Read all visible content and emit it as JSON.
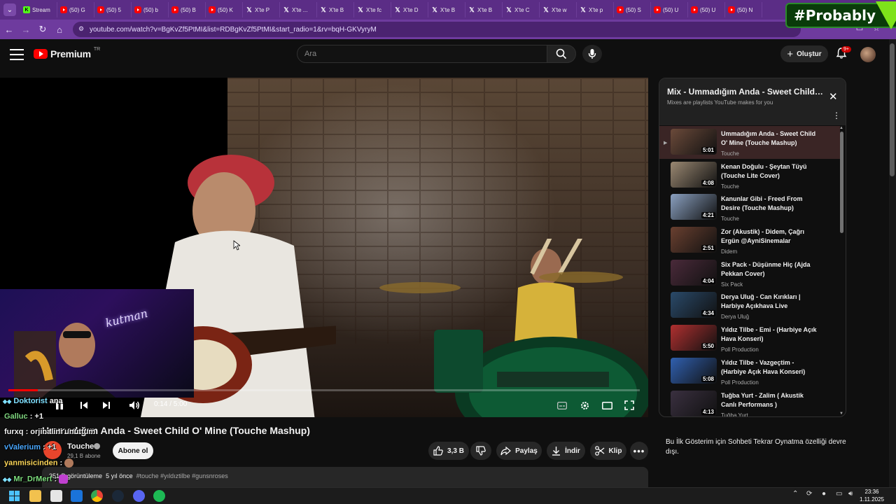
{
  "browser": {
    "tabs": [
      {
        "icon": "kick-icon",
        "label": "Stream"
      },
      {
        "icon": "youtube-icon",
        "label": "(50) G"
      },
      {
        "icon": "youtube-icon",
        "label": "(50) 5"
      },
      {
        "icon": "youtube-icon",
        "label": "(50) b"
      },
      {
        "icon": "youtube-icon",
        "label": "(50) B"
      },
      {
        "icon": "youtube-icon",
        "label": "(50) K"
      },
      {
        "icon": "x-icon",
        "label": "X'te P"
      },
      {
        "icon": "x-icon",
        "label": "X'te ..."
      },
      {
        "icon": "x-icon",
        "label": "X'te B"
      },
      {
        "icon": "x-icon",
        "label": "X'te fc"
      },
      {
        "icon": "x-icon",
        "label": "X'te D"
      },
      {
        "icon": "x-icon",
        "label": "X'te B"
      },
      {
        "icon": "x-icon",
        "label": "X'te B"
      },
      {
        "icon": "x-icon",
        "label": "X'te C"
      },
      {
        "icon": "x-icon",
        "label": "X'te w"
      },
      {
        "icon": "x-icon",
        "label": "X'te p"
      },
      {
        "icon": "youtube-icon",
        "label": "(50) S"
      },
      {
        "icon": "youtube-icon",
        "label": "(50) U"
      },
      {
        "icon": "youtube-icon",
        "label": "(50) U"
      },
      {
        "icon": "youtube-icon",
        "label": "(50) N"
      }
    ],
    "url": "youtube.com/watch?v=BgKvZf5PtMI&list=RDBgKvZf5PtMI&start_radio=1&rv=bqH-GKVyryM"
  },
  "overlay_badge": "#Probably",
  "youtube": {
    "logo_text": "Premium",
    "logo_sup": "TR",
    "search_placeholder": "Ara",
    "create_label": "Oluştur",
    "notif_count": "9+"
  },
  "player": {
    "time": "0:14 / 5:00",
    "progress": 0.047,
    "webcam_neon": "kutman"
  },
  "video": {
    "title": "Ummadığım Anda - Sweet Child O' Mine (Touche Mashup)",
    "channel": "Touche",
    "subscribers": "29,1 B abone",
    "subscribe_label": "Abone ol",
    "likes": "3,3 B",
    "share_label": "Paylaş",
    "download_label": "İndir",
    "clip_label": "Klip",
    "views": "351 B görüntüleme",
    "age": "5 yıl önce",
    "tags": "#touche #yıldıztilbe #gunsnroses"
  },
  "chat": [
    {
      "user": "Doktorist",
      "text": "ana",
      "color": "#7fe0ff"
    },
    {
      "user": "Galluc",
      "text": ": +1",
      "color": "#7fd67f"
    },
    {
      "user": "furxq",
      "text": ": orjinalini unuttum",
      "color": "#ffffff"
    },
    {
      "user": "vValerium",
      "text": ": +1",
      "color": "#4aa8ff"
    },
    {
      "user": "yanmisicinden",
      "text": ":",
      "color": "#ffd85a"
    },
    {
      "user": "Mr_DrMert",
      "text": ":",
      "color": "#7fe07f"
    }
  ],
  "playlist": {
    "title": "Mix - Ummadığım Anda - Sweet Child O' Mine (Touche Mashup)",
    "subtitle": "Mixes are playlists YouTube makes for you",
    "items": [
      {
        "title": "Ummadığım Anda - Sweet Child O' Mine (Touche Mashup)",
        "channel": "Touche",
        "duration": "5:01",
        "current": true,
        "thumb": "#6b4a3a"
      },
      {
        "title": "Kenan Doğulu - Şeytan Tüyü (Touche Lite Cover)",
        "channel": "Touche",
        "duration": "4:08",
        "current": false,
        "thumb": "#9a8872"
      },
      {
        "title": "Kanunlar Gibi - Freed From Desire (Touche Mashup)",
        "channel": "Touche",
        "duration": "4:21",
        "current": false,
        "thumb": "#8aa0c0"
      },
      {
        "title": "Zor (Akustik) - Didem, Çağrı Ergün @AyniSinemalar",
        "channel": "Didem",
        "duration": "2:51",
        "current": false,
        "thumb": "#6a4030"
      },
      {
        "title": "Six Pack - Düşünme Hiç (Ajda Pekkan Cover)",
        "channel": "Six Pack",
        "duration": "4:04",
        "current": false,
        "thumb": "#4a2a3a"
      },
      {
        "title": "Derya Uluğ - Can Kırıkları | Harbiye Açıkhava Live",
        "channel": "Derya Uluğ",
        "duration": "4:34",
        "current": false,
        "thumb": "#2a4a6a"
      },
      {
        "title": "Yıldız Tilbe - Emi - (Harbiye Açık Hava Konseri)",
        "channel": "Poll Production",
        "duration": "5:50",
        "current": false,
        "thumb": "#b03030"
      },
      {
        "title": "Yıldız Tilbe - Vazgeçtim - (Harbiye Açık Hava Konseri)",
        "channel": "Poll Production",
        "duration": "5:08",
        "current": false,
        "thumb": "#3060b0"
      },
      {
        "title": "Tuğba Yurt - Zalim ( Akustik Canlı Performans )",
        "channel": "Tuğba Yurt",
        "duration": "4:13",
        "current": false,
        "thumb": "#3a3040"
      }
    ]
  },
  "chat_replay_note": "Bu İlk Gösterim için Sohbeti Tekrar Oynatma özelliği devre dışı.",
  "taskbar": {
    "time": "23:36",
    "date": "1.11.2025"
  }
}
